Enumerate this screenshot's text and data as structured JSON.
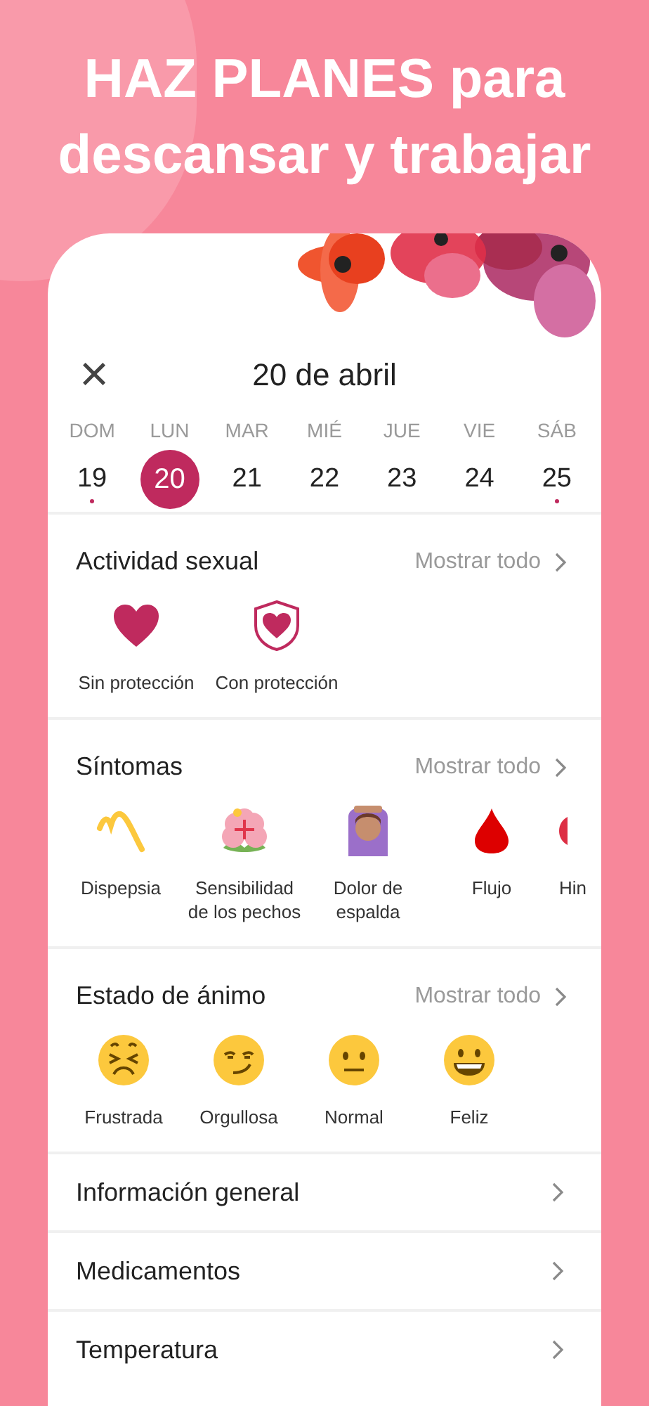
{
  "headline": "**HAZ PLANES** para descansar y trabajar",
  "header": {
    "close": "×",
    "title": "20 de abril"
  },
  "days": [
    {
      "weekday": "DOM",
      "date": "19",
      "selected": false,
      "marked": true
    },
    {
      "weekday": "LUN",
      "date": "20",
      "selected": true,
      "marked": false
    },
    {
      "weekday": "MAR",
      "date": "21",
      "selected": false,
      "marked": false
    },
    {
      "weekday": "MIÉ",
      "date": "22",
      "selected": false,
      "marked": false
    },
    {
      "weekday": "JUE",
      "date": "23",
      "selected": false,
      "marked": false
    },
    {
      "weekday": "VIE",
      "date": "24",
      "selected": false,
      "marked": false
    },
    {
      "weekday": "SÁB",
      "date": "25",
      "selected": false,
      "marked": true
    }
  ],
  "sections": [
    {
      "kind": "options",
      "title": "Actividad sexual",
      "show_all": "Mostrar todo",
      "items": [
        {
          "label": "Sin protección"
        },
        {
          "label": "Con protección"
        }
      ]
    },
    {
      "kind": "options",
      "title": "Síntomas",
      "show_all": "Mostrar todo",
      "items": [
        {
          "label": "Dispepsia"
        },
        {
          "label": "Sensibilidad de los pechos"
        },
        {
          "label": "Dolor de espalda"
        },
        {
          "label": "Flujo"
        },
        {
          "label": "Hin"
        }
      ]
    },
    {
      "kind": "options",
      "title": "Estado de ánimo",
      "show_all": "Mostrar todo",
      "items": [
        {
          "label": "Frustrada"
        },
        {
          "label": "Orgullosa"
        },
        {
          "label": "Normal"
        },
        {
          "label": "Feliz"
        }
      ]
    },
    {
      "kind": "link",
      "title": "Información general"
    },
    {
      "kind": "link",
      "title": "Medicamentos"
    },
    {
      "kind": "link",
      "title": "Temperatura"
    }
  ]
}
